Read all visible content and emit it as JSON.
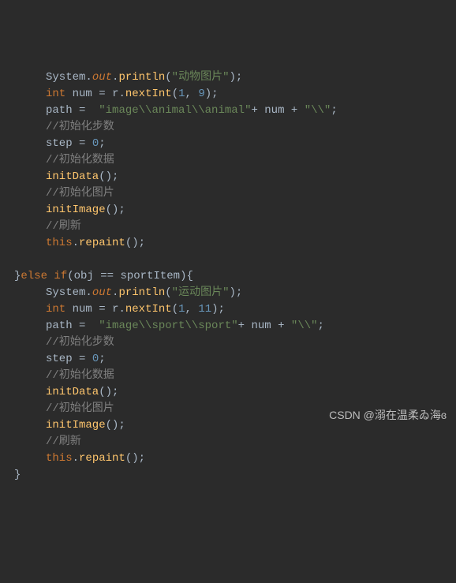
{
  "lines": [
    {
      "indent": 2,
      "html": "<span class='cls'>System</span><span class='punct'>.</span><span class='static'>out</span><span class='punct'>.</span><span class='method'>println</span><span class='punct'>(</span><span class='str'>\"动物图片\"</span><span class='punct'>);</span>"
    },
    {
      "indent": 2,
      "html": "<span class='kw'>int</span> <span class='ident'>num</span> <span class='punct'>=</span> <span class='ident'>r</span><span class='punct'>.</span><span class='method'>nextInt</span><span class='punct'>(</span><span class='num'>1</span><span class='punct'>, </span><span class='num'>9</span><span class='punct'>);</span>"
    },
    {
      "indent": 2,
      "html": "<span class='ident'>path</span> <span class='punct'>=</span>  <span class='str'>\"image\\\\animal\\\\animal\"</span><span class='punct'>+ </span><span class='ident'>num</span><span class='punct'> + </span><span class='str'>\"\\\\\"</span><span class='punct'>;</span>"
    },
    {
      "indent": 2,
      "html": "<span class='comment'>//初始化步数</span>"
    },
    {
      "indent": 2,
      "html": "<span class='ident'>step</span> <span class='punct'>=</span> <span class='num'>0</span><span class='punct'>;</span>"
    },
    {
      "indent": 2,
      "html": "<span class='comment'>//初始化数据</span>"
    },
    {
      "indent": 2,
      "html": "<span class='method'>initData</span><span class='punct'>();</span>"
    },
    {
      "indent": 2,
      "html": "<span class='comment'>//初始化图片</span>"
    },
    {
      "indent": 2,
      "html": "<span class='method'>initImage</span><span class='punct'>();</span>"
    },
    {
      "indent": 2,
      "html": "<span class='comment'>//刷新</span>"
    },
    {
      "indent": 2,
      "html": "<span class='kw'>this</span><span class='punct'>.</span><span class='method'>repaint</span><span class='punct'>();</span>"
    },
    {
      "indent": 2,
      "html": ""
    },
    {
      "indent": 1,
      "html": "<span class='punct'>}</span><span class='kw'>else if</span><span class='punct'>(</span><span class='ident'>obj</span> <span class='punct'>==</span> <span class='ident'>sportItem</span><span class='punct'>){</span>"
    },
    {
      "indent": 2,
      "html": "<span class='cls'>System</span><span class='punct'>.</span><span class='static'>out</span><span class='punct'>.</span><span class='method'>println</span><span class='punct'>(</span><span class='str'>\"运动图片\"</span><span class='punct'>);</span>"
    },
    {
      "indent": 2,
      "html": "<span class='kw'>int</span> <span class='ident'>num</span> <span class='punct'>=</span> <span class='ident'>r</span><span class='punct'>.</span><span class='method'>nextInt</span><span class='punct'>(</span><span class='num'>1</span><span class='punct'>, </span><span class='num'>11</span><span class='punct'>);</span>"
    },
    {
      "indent": 2,
      "html": "<span class='ident'>path</span> <span class='punct'>=</span>  <span class='str'>\"image\\\\sport\\\\sport\"</span><span class='punct'>+ </span><span class='ident'>num</span><span class='punct'> + </span><span class='str'>\"\\\\\"</span><span class='punct'>;</span>"
    },
    {
      "indent": 2,
      "html": "<span class='comment'>//初始化步数</span>"
    },
    {
      "indent": 2,
      "html": "<span class='ident'>step</span> <span class='punct'>=</span> <span class='num'>0</span><span class='punct'>;</span>"
    },
    {
      "indent": 2,
      "html": "<span class='comment'>//初始化数据</span>"
    },
    {
      "indent": 2,
      "html": "<span class='method'>initData</span><span class='punct'>();</span>"
    },
    {
      "indent": 2,
      "html": "<span class='comment'>//初始化图片</span>"
    },
    {
      "indent": 2,
      "html": "<span class='method'>initImage</span><span class='punct'>();</span>"
    },
    {
      "indent": 2,
      "html": "<span class='comment'>//刷新</span>"
    },
    {
      "indent": 2,
      "html": "<span class='kw'>this</span><span class='punct'>.</span><span class='method'>repaint</span><span class='punct'>();</span>"
    },
    {
      "indent": 1,
      "html": "<span class='punct'>}</span>"
    }
  ],
  "watermark": "CSDN @溺在温柔ゐ海ɞ"
}
